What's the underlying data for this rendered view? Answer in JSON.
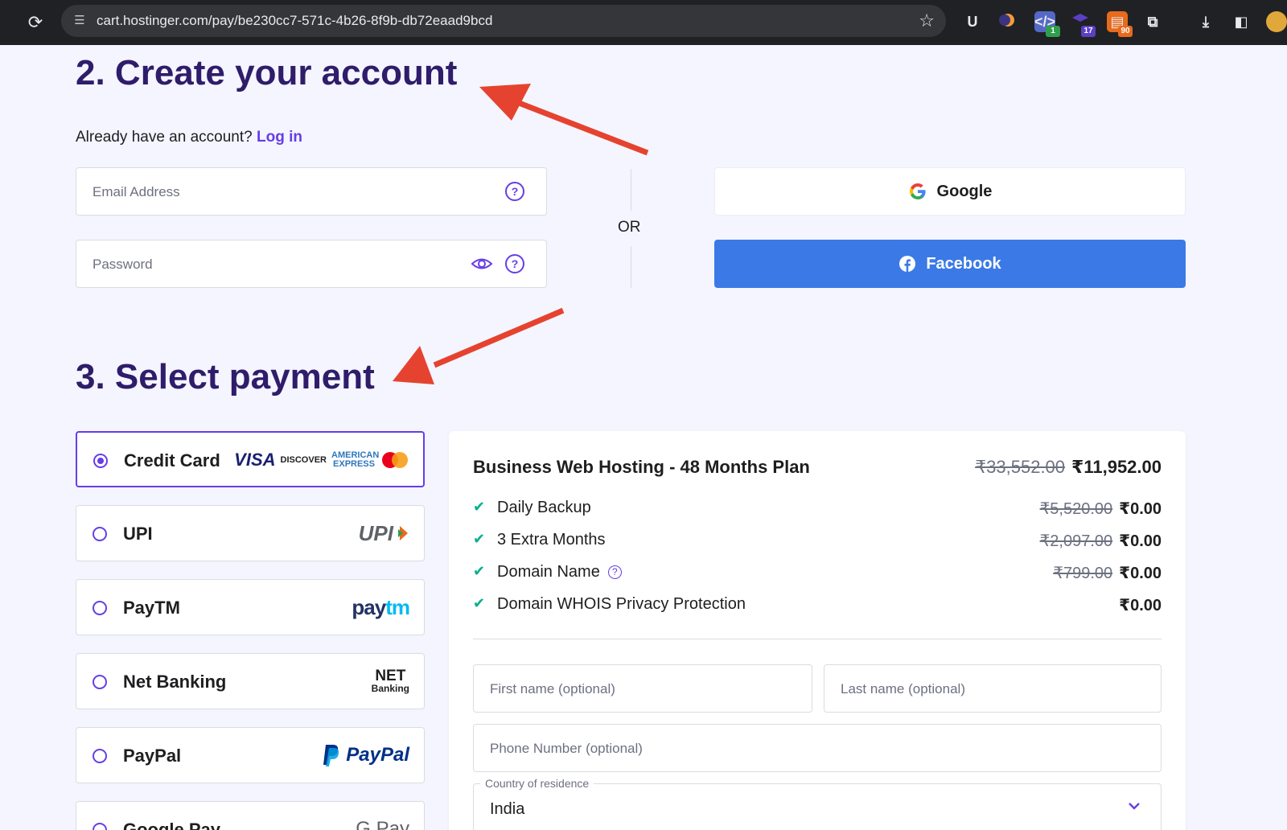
{
  "browser": {
    "url": "cart.hostinger.com/pay/be230cc7-571c-4b26-8f9b-db72eaad9bcd",
    "extension_badges": [
      "1",
      "17",
      "90"
    ]
  },
  "account": {
    "heading": "2. Create your account",
    "already_text": "Already have an account?",
    "login_link": "Log in",
    "email_placeholder": "Email Address",
    "password_placeholder": "Password",
    "or_text": "OR",
    "google_label": "Google",
    "facebook_label": "Facebook"
  },
  "payment": {
    "heading": "3. Select payment",
    "options": [
      {
        "label": "Credit Card",
        "selected": true
      },
      {
        "label": "UPI",
        "selected": false
      },
      {
        "label": "PayTM",
        "selected": false
      },
      {
        "label": "Net Banking",
        "selected": false
      },
      {
        "label": "PayPal",
        "selected": false
      },
      {
        "label": "Google Pay",
        "selected": false
      }
    ],
    "logos": {
      "visa": "VISA",
      "discover": "DISCOVER",
      "amex": "AMERICAN EXPRESS",
      "upi": "UPI",
      "paytm_a": "pay",
      "paytm_b": "tm",
      "net": "NET",
      "banking": "Banking",
      "paypal": "PayPal",
      "gpay": "G Pay"
    }
  },
  "summary": {
    "plan_title": "Business Web Hosting - 48 Months Plan",
    "plan_old_price": "₹33,552.00",
    "plan_price": "₹11,952.00",
    "features": [
      {
        "name": "Daily Backup",
        "old": "₹5,520.00",
        "price": "₹0.00"
      },
      {
        "name": "3 Extra Months",
        "old": "₹2,097.00",
        "price": "₹0.00"
      },
      {
        "name": "Domain Name",
        "old": "₹799.00",
        "price": "₹0.00"
      },
      {
        "name": "Domain WHOIS Privacy Protection",
        "old": "",
        "price": "₹0.00"
      }
    ],
    "first_name_placeholder": "First name (optional)",
    "last_name_placeholder": "Last name (optional)",
    "phone_placeholder": "Phone Number (optional)",
    "country_label": "Country of residence",
    "country_value": "India"
  },
  "colors": {
    "brand": "#673de6",
    "heading": "#2f1c6a",
    "facebook": "#3b7ae6",
    "annotation_arrow": "#e5432f"
  }
}
